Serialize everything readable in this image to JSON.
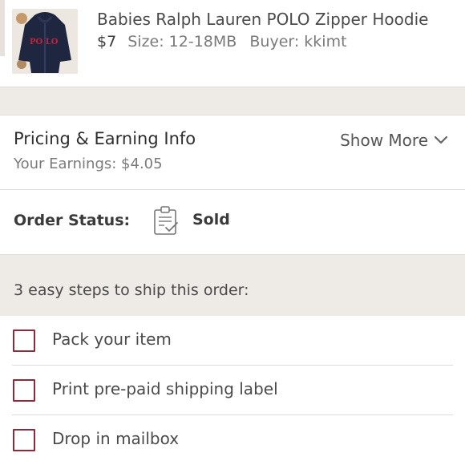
{
  "item": {
    "title": "Babies Ralph Lauren POLO Zipper Hoodie",
    "price": "$7",
    "size": "Size: 12-18MB",
    "buyer": "Buyer: kkimt",
    "thumb_text": "PO LO"
  },
  "pricing": {
    "title": "Pricing & Earning Info",
    "earnings": "Your Earnings: $4.05",
    "show_more": "Show More"
  },
  "order_status": {
    "label": "Order Status:",
    "value": "Sold",
    "icon": "clipboard-check-icon"
  },
  "steps": {
    "header": "3 easy steps to ship this order:",
    "items": [
      {
        "label": "Pack your item",
        "checked": false
      },
      {
        "label": "Print pre-paid shipping label",
        "checked": false
      },
      {
        "label": "Drop in mailbox",
        "checked": false
      }
    ]
  },
  "colors": {
    "checkbox_border": "#8a2a3c",
    "section_bg": "#eeebe6",
    "divider": "#dcdcdc"
  }
}
